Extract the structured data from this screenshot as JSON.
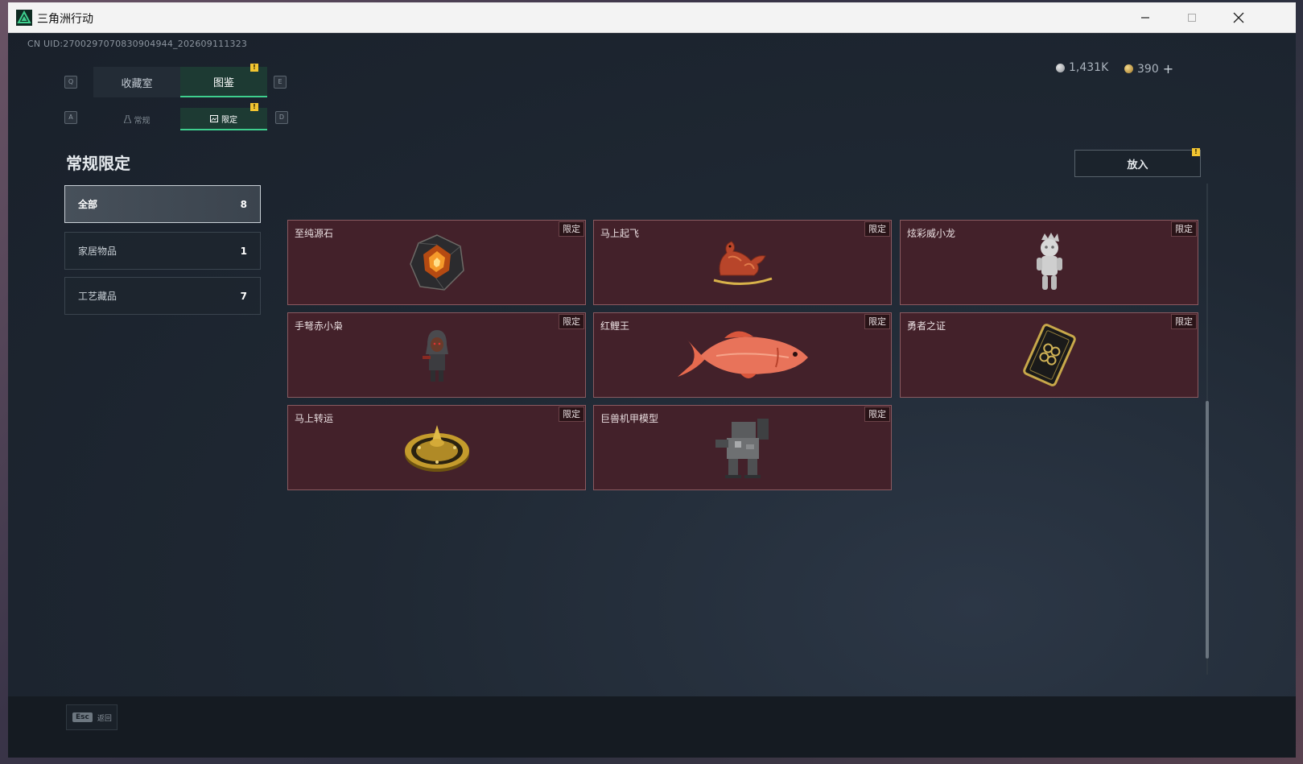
{
  "window": {
    "title": "三角洲行动",
    "accent": "#3ecf8e"
  },
  "header": {
    "uid": "CN UID:2700297070830904944_202609111323",
    "silver_amount": "1,431K",
    "gold_amount": "390",
    "gold_add": "+"
  },
  "tabs": {
    "left_key": "Q",
    "right_key": "E",
    "items": [
      {
        "label": "收藏室",
        "active": false
      },
      {
        "label": "图鉴",
        "active": true
      }
    ],
    "badge": "!"
  },
  "subtabs": {
    "left_key": "A",
    "right_key": "D",
    "items": [
      {
        "label": "常规",
        "icon": "flask-icon",
        "active": false
      },
      {
        "label": "限定",
        "icon": "picture-icon",
        "active": true
      }
    ],
    "badge": "!"
  },
  "section": {
    "title": "常规限定"
  },
  "categories": [
    {
      "label": "全部",
      "count": "8",
      "active": true
    },
    {
      "label": "家居物品",
      "count": "1",
      "active": false
    },
    {
      "label": "工艺藏品",
      "count": "7",
      "active": false
    }
  ],
  "put_button": {
    "label": "放入",
    "badge": "!"
  },
  "items": [
    {
      "name": "至纯源石",
      "tag": "限定",
      "icon": "crystal-icon"
    },
    {
      "name": "马上起飞",
      "tag": "限定",
      "icon": "horse-icon"
    },
    {
      "name": "炫彩威小龙",
      "tag": "限定",
      "icon": "figurine-icon"
    },
    {
      "name": "手弩赤小枭",
      "tag": "限定",
      "icon": "hooded-figure-icon"
    },
    {
      "name": "红鲤王",
      "tag": "限定",
      "icon": "carp-icon"
    },
    {
      "name": "勇者之证",
      "tag": "限定",
      "icon": "card-icon"
    },
    {
      "name": "马上转运",
      "tag": "限定",
      "icon": "gold-disc-icon"
    },
    {
      "name": "巨兽机甲模型",
      "tag": "限定",
      "icon": "mech-icon"
    }
  ],
  "footer": {
    "esc_key": "Esc",
    "esc_label": "返回"
  }
}
